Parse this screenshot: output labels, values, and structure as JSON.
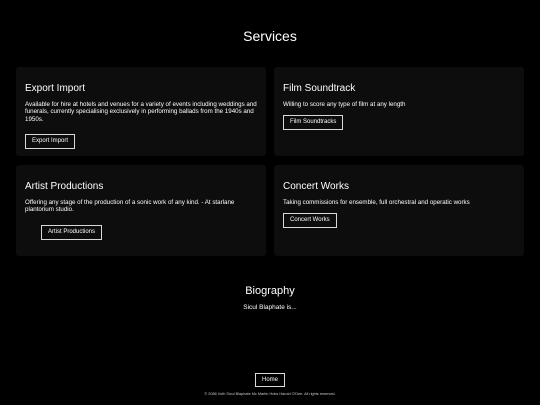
{
  "services": {
    "title": "Services",
    "cards": [
      {
        "title": "Export Import",
        "description": "Available for hire at hotels and venues for a variety of events including weddings and funerals, currently specialising exclusively in performing ballads from the 1940s and 1950s.",
        "button": "Export Import"
      },
      {
        "title": "Film Soundtrack",
        "description": "Willing to score any type of film at any length",
        "button": "Film Soundtracks"
      },
      {
        "title": "Artist Productions",
        "description": "Offering any stage of the production of a sonic work of any kind. - At starlane plantorium studio.",
        "button": "Artist Productions"
      },
      {
        "title": "Concert Works",
        "description": "Taking commissions for ensemble, full orchestral and operatic works",
        "button": "Concert Works"
      }
    ]
  },
  "biography": {
    "title": "Biography",
    "text": "Sicul Blaphate is..."
  },
  "footer": {
    "home_button": "Home",
    "copyright": "© 2086 Voth Sicul Blaphate Mc Martin Hubs Harold O'Dee. All rights reserved."
  },
  "colors": {
    "background": "#000000",
    "card_background": "#0d0d0d",
    "text": "#ffffff",
    "button_border": "#d8d8d8"
  }
}
